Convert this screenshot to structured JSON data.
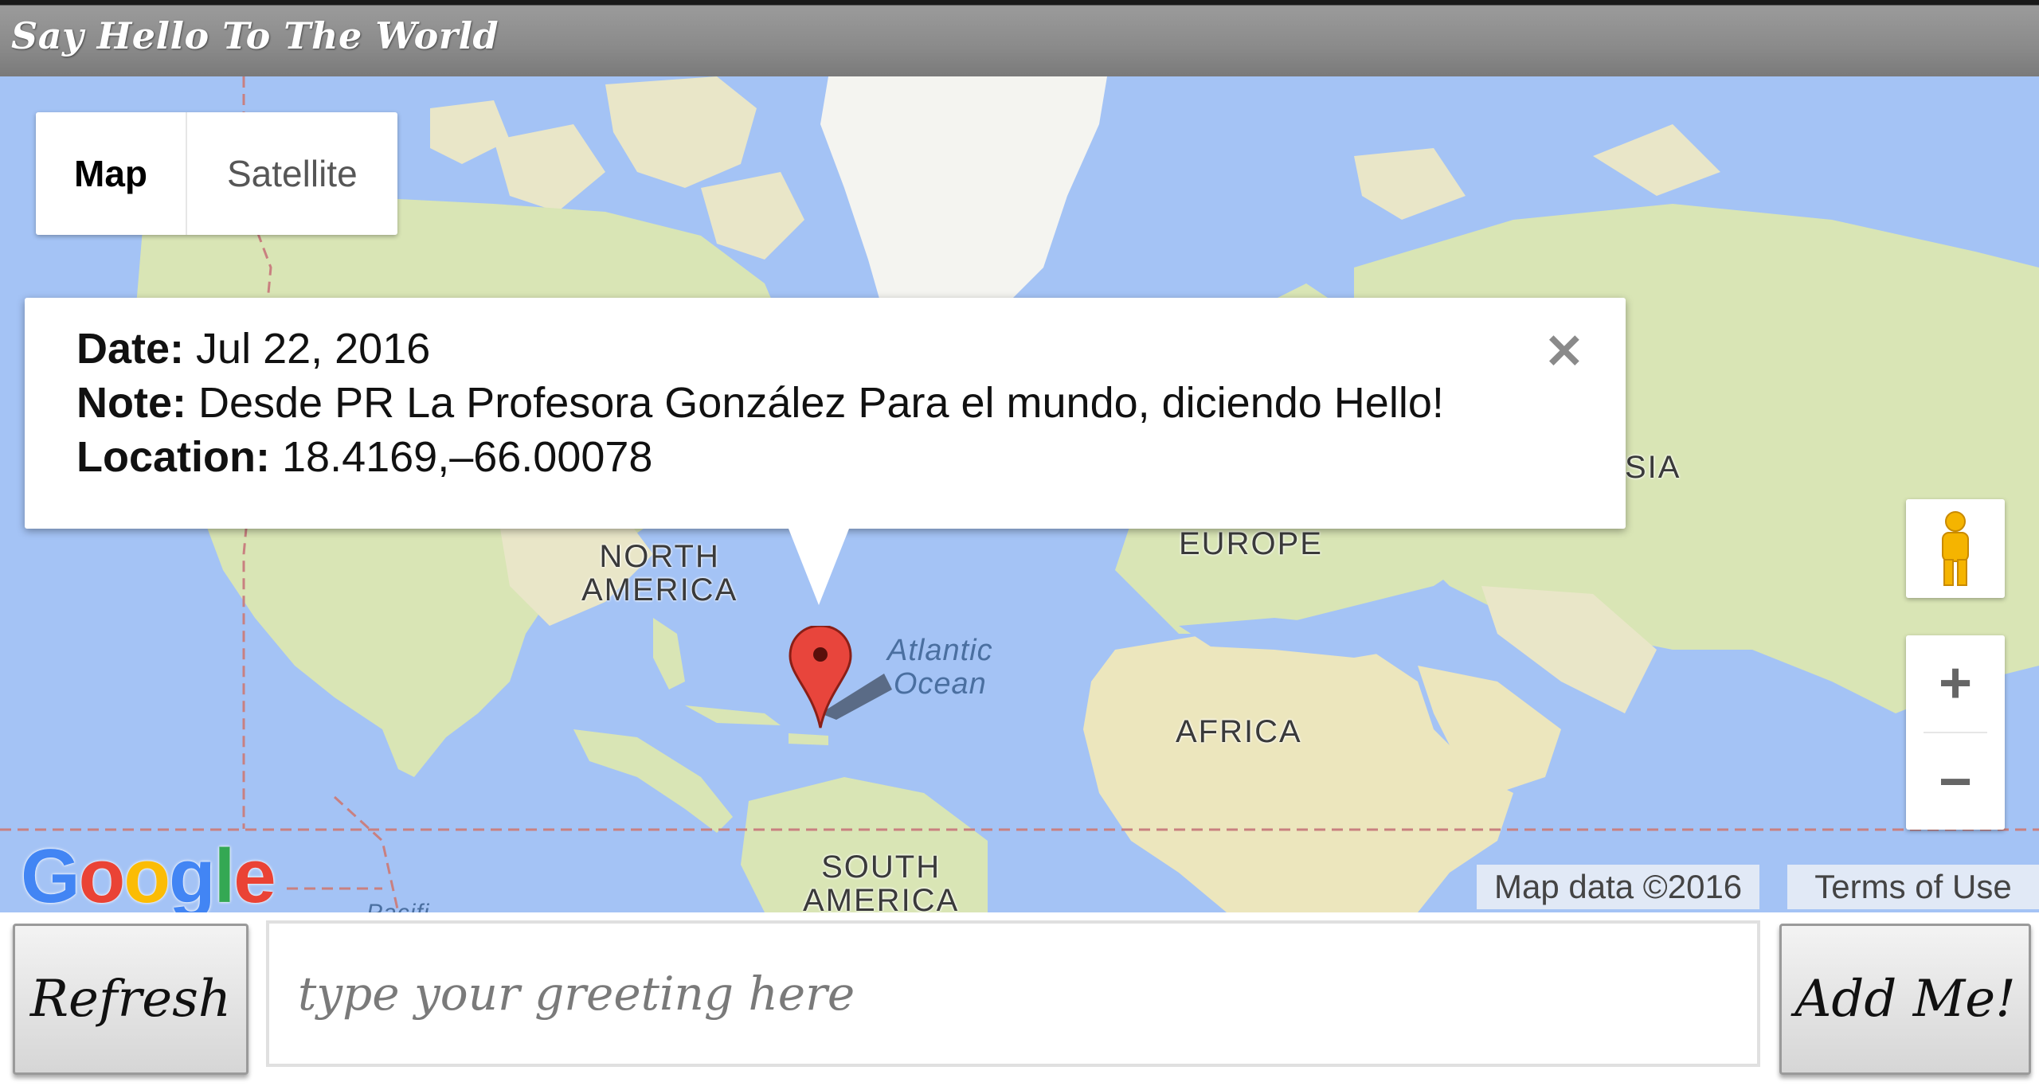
{
  "app": {
    "title": "Say Hello To The World"
  },
  "map": {
    "type_control": {
      "map_label": "Map",
      "satellite_label": "Satellite",
      "selected": "Map"
    },
    "labels": {
      "north_america_1": "NORTH",
      "north_america_2": "AMERICA",
      "south_america_1": "SOUTH",
      "south_america_2": "AMERICA",
      "europe": "EUROPE",
      "africa": "AFRICA",
      "asia": "SIA",
      "atlantic_1": "Atlantic",
      "atlantic_2": "Ocean",
      "pacific": "Pacifi"
    },
    "info_window": {
      "date_label": "Date:",
      "date_value": "Jul 22, 2016",
      "note_label": "Note:",
      "note_value": "Desde PR La Profesora González Para el mundo, diciendo Hello!",
      "location_label": "Location:",
      "location_value": "18.4169,–66.00078"
    },
    "zoom_in": "+",
    "zoom_out": "−",
    "attribution": "Map data ©2016",
    "terms": "Terms of Use",
    "logo_letters": [
      "G",
      "o",
      "o",
      "g",
      "l",
      "e"
    ],
    "colors": {
      "water": "#a4c3f5",
      "land": "#e6e3c4",
      "marker": "#e8453c"
    },
    "icons": {
      "marker": "map-pin-icon",
      "pegman": "pegman-icon",
      "close": "close-icon"
    }
  },
  "controls": {
    "refresh_label": "Refresh",
    "add_label": "Add Me!",
    "greeting_placeholder": "type your greeting here",
    "greeting_value": ""
  }
}
